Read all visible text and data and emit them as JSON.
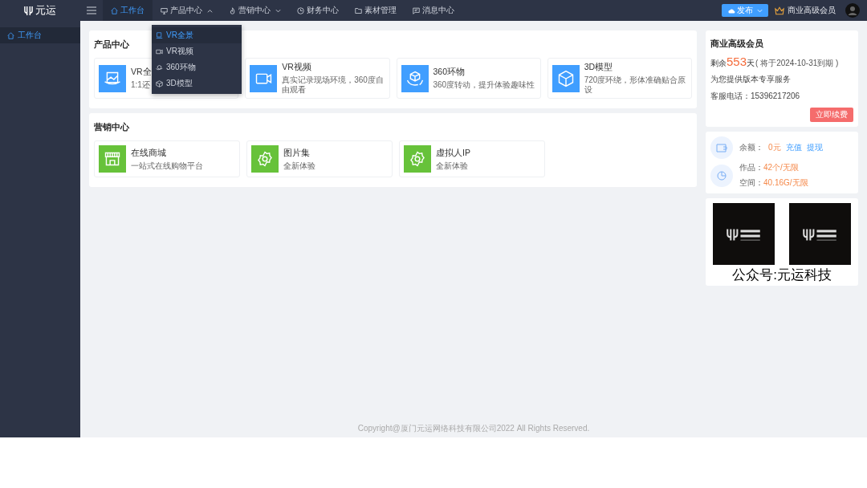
{
  "logo": {
    "text": "元运"
  },
  "nav": [
    {
      "label": "工作台",
      "kind": "home",
      "selected": true
    },
    {
      "label": "产品中心",
      "kind": "screen",
      "selected": false,
      "expanded": true
    },
    {
      "label": "营销中心",
      "kind": "fire",
      "selected": false,
      "expanded": false
    },
    {
      "label": "财务中心",
      "kind": "clock",
      "selected": false
    },
    {
      "label": "素材管理",
      "kind": "folder",
      "selected": false
    },
    {
      "label": "消息中心",
      "kind": "message",
      "selected": false
    }
  ],
  "publish_button": {
    "label": "发布"
  },
  "membership_badge": {
    "label": "商业高级会员"
  },
  "sidebar": {
    "items": [
      {
        "label": "工作台",
        "selected": true
      }
    ]
  },
  "dropdown": {
    "items": [
      {
        "label": "VR全景",
        "kind": "pano",
        "selected": true
      },
      {
        "label": "VR视频",
        "kind": "video",
        "selected": false
      },
      {
        "label": "360环物",
        "kind": "rotate",
        "selected": false
      },
      {
        "label": "3D模型",
        "kind": "cube",
        "selected": false
      }
    ]
  },
  "sections": [
    {
      "title": "产品中心",
      "color": "#409eff",
      "cards": [
        {
          "title": "VR全",
          "desc": "1:1还",
          "kind": "pano"
        },
        {
          "title": "VR视频",
          "desc": "真实记录现场环境，360度自由观看",
          "kind": "video"
        },
        {
          "title": "360环物",
          "desc": "360度转动，提升体验趣味性",
          "kind": "rotate"
        },
        {
          "title": "3D模型",
          "desc": "720度环绕，形体准确贴合原设",
          "kind": "cube"
        }
      ]
    },
    {
      "title": "营销中心",
      "color": "#67c23a",
      "cards": [
        {
          "title": "在线商城",
          "desc": "一站式在线购物平台",
          "kind": "shop"
        },
        {
          "title": "图片集",
          "desc": "全新体验",
          "kind": "gear"
        },
        {
          "title": "虚拟人IP",
          "desc": "全新体验",
          "kind": "gear"
        }
      ]
    }
  ],
  "member_card": {
    "title": "商业高级会员",
    "remaining_prefix": "剩余",
    "days": "553",
    "days_unit": "天",
    "expiry": "( 将于2024-10-31到期 )",
    "service": "为您提供版本专享服务",
    "phone": "客服电话：15396217206",
    "renew_button": "立即续费"
  },
  "account": {
    "balance_label": "余额：",
    "balance": "0元",
    "recharge_link": "充值",
    "withdraw_link": "提现",
    "works_label": "作品：",
    "works": "42个/无限",
    "space_label": "空间：",
    "space": "40.16G/无限"
  },
  "qr_card": {
    "caption": "公众号:元运科技"
  },
  "footer": {
    "copyright": "Copyright@厦门元运网络科技有限公司2022 All Rights Reserved."
  }
}
